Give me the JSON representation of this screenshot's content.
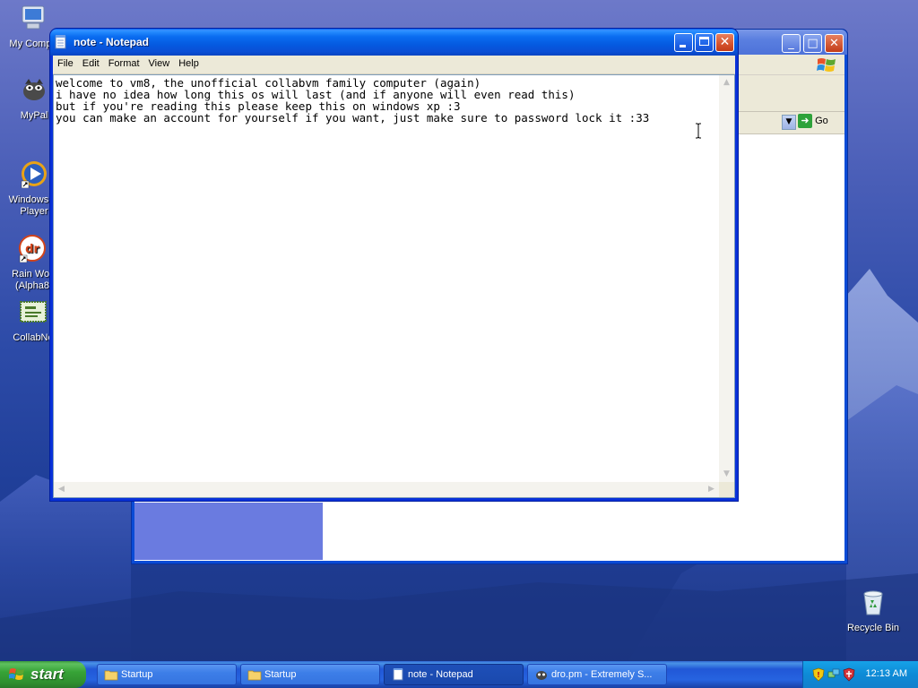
{
  "desktop": {
    "icons": [
      {
        "label": "My Compu",
        "icon": "my-computer-icon"
      },
      {
        "label": "MyPal",
        "icon": "mypal-browser-icon"
      },
      {
        "label": "Windows M\nPlayer",
        "icon": "windows-media-player-icon"
      },
      {
        "label": "Rain Wor\n(Alpha8",
        "icon": "rain-world-icon"
      },
      {
        "label": "CollabNe",
        "icon": "collabnet-icon"
      },
      {
        "label": "Recycle Bin",
        "icon": "recycle-bin-icon"
      }
    ]
  },
  "background_window": {
    "go_label": "Go"
  },
  "notepad": {
    "title": "note - Notepad",
    "menu": [
      "File",
      "Edit",
      "Format",
      "View",
      "Help"
    ],
    "content": "welcome to vm8, the unofficial collabvm family computer (again)\ni have no idea how long this os will last (and if anyone will even read this)\nbut if you're reading this please keep this on windows xp :3\nyou can make an account for yourself if you want, just make sure to password lock it :33"
  },
  "taskbar": {
    "start_label": "start",
    "tasks": [
      {
        "label": "Startup",
        "icon": "folder-icon",
        "active": false
      },
      {
        "label": "Startup",
        "icon": "folder-icon",
        "active": false
      },
      {
        "label": "note - Notepad",
        "icon": "notepad-icon",
        "active": true
      },
      {
        "label": "dro.pm - Extremely S...",
        "icon": "mypal-browser-icon",
        "active": false
      }
    ],
    "clock": "12:13 AM"
  },
  "colors": {
    "title_blue": "#0a5ae0",
    "start_green": "#37a337",
    "tray_blue": "#0e8ad6"
  }
}
